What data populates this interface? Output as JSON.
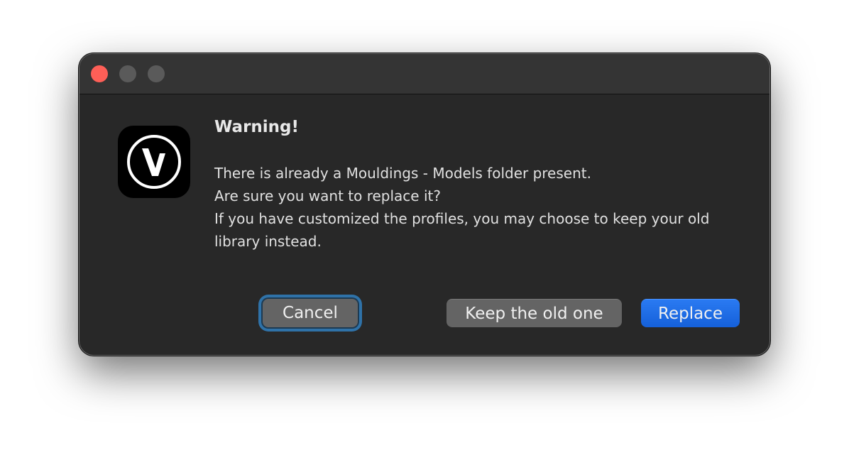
{
  "dialog": {
    "title": "Warning!",
    "message_lines": [
      "There is already a Mouldings - Models folder present.",
      "Are sure you want to replace it?",
      "If you have customized the profiles, you may choose to keep your old",
      "library instead."
    ],
    "app_icon": "vectorworks-v-logo-icon"
  },
  "buttons": {
    "cancel_label": "Cancel",
    "keep_label": "Keep the old one",
    "replace_label": "Replace"
  },
  "colors": {
    "window_bg": "#282828",
    "titlebar_bg": "#343434",
    "close_button": "#fe5f57",
    "default_button": "#1f6feb",
    "focus_ring": "#2f72a8"
  }
}
